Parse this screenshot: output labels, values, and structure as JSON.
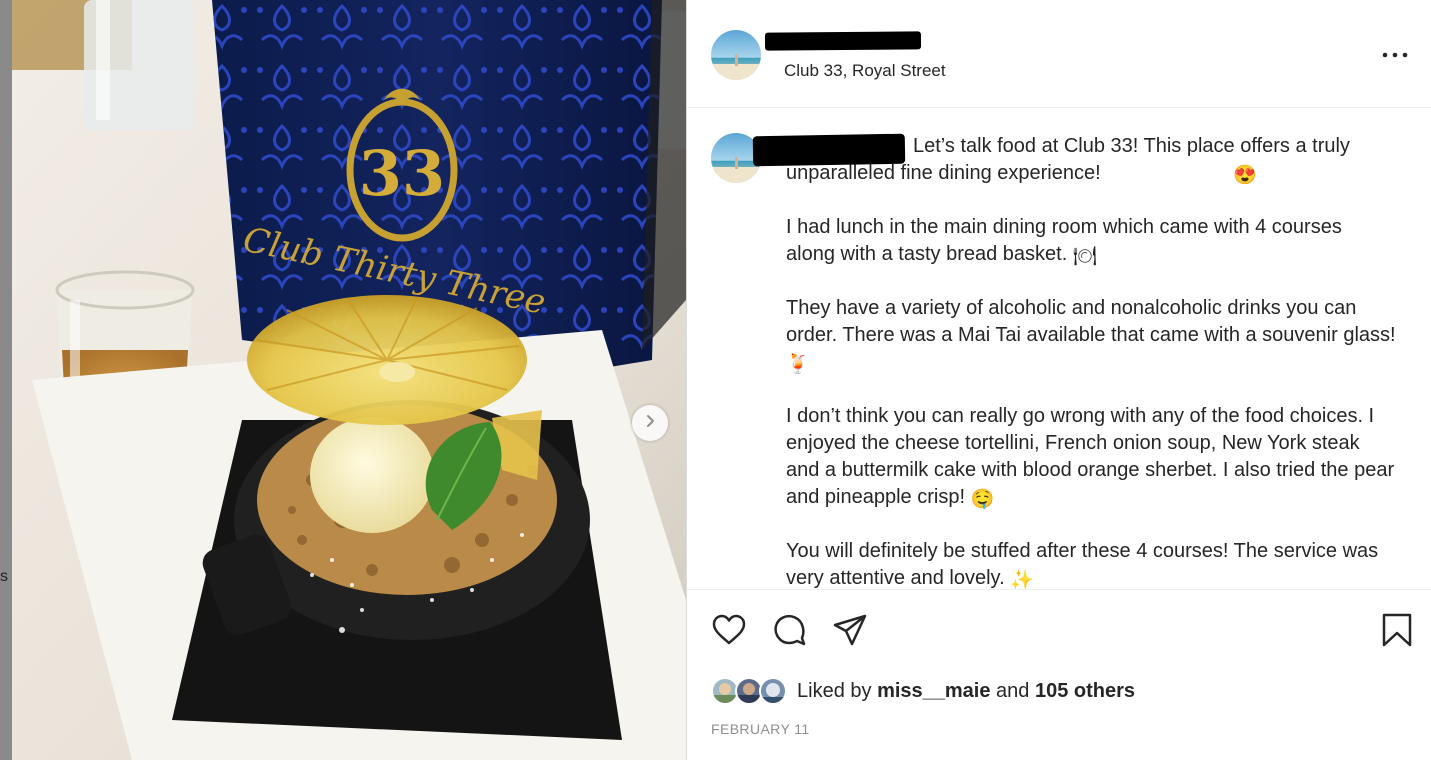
{
  "post": {
    "location": "Club 33, Royal Street",
    "caption_paragraphs": [
      {
        "text": "Let’s talk food at Club 33! This place offers a truly unparalleled fine dining experience!",
        "emoji": "😍"
      },
      {
        "text": "I had lunch in the main dining room which came with 4 courses along with a tasty bread basket.",
        "emoji": "🍽"
      },
      {
        "text": "They have a variety of alcoholic and nonalcoholic drinks you can order. There was a Mai Tai available that came with a souvenir glass!",
        "emoji": "🍹"
      },
      {
        "text": "I don’t think you can really go wrong with any of the food choices. I enjoyed the cheese tortellini, French onion soup, New York steak and a buttermilk cake with blood orange sherbet. I also tried the pear and pineapple crisp!",
        "emoji": "🤤"
      },
      {
        "text": "You will definitely be stuffed after these 4 courses! The service was very attentive and lovely.",
        "emoji": "✨"
      }
    ],
    "likes": {
      "prefix": "Liked by",
      "user": "miss__maie",
      "joiner": "and",
      "others": "105 others"
    },
    "date": "FEBRUARY 11",
    "edge_char": "s"
  },
  "icons": {
    "like": "heart-icon",
    "comment": "comment-icon",
    "share": "send-icon",
    "save": "bookmark-icon",
    "more": "more-dots-icon",
    "next": "chevron-right-icon"
  },
  "colors": {
    "text": "#262626",
    "muted": "#8e8e8e",
    "divider": "#efefef"
  }
}
